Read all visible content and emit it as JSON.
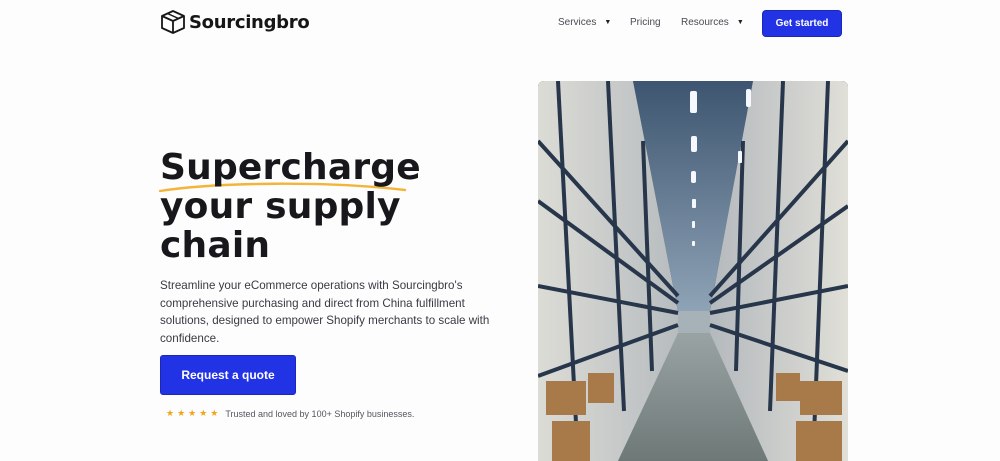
{
  "brand": {
    "name": "Sourcingbro",
    "logo_icon": "box-icon"
  },
  "nav": {
    "items": [
      {
        "label": "Services",
        "has_dropdown": true
      },
      {
        "label": "Pricing",
        "has_dropdown": false
      },
      {
        "label": "Resources",
        "has_dropdown": true
      }
    ],
    "cta_label": "Get started"
  },
  "hero": {
    "headline_lines": [
      "Supercharge",
      "your supply",
      "chain"
    ],
    "subheadline": "Streamline your eCommerce operations with Sourcingbro's comprehensive purchasing and direct from China fulfillment solutions, designed to empower Shopify merchants to scale with confidence.",
    "cta_label": "Request a quote",
    "rating_stars": 5,
    "trust_text": "Trusted and loved by 100+ Shopify businesses."
  },
  "image": {
    "subject": "warehouse-aisle"
  },
  "colors": {
    "accent": "#2233e6",
    "star": "#f2a51a",
    "underline": "#f2b53a",
    "text": "#17171c"
  }
}
